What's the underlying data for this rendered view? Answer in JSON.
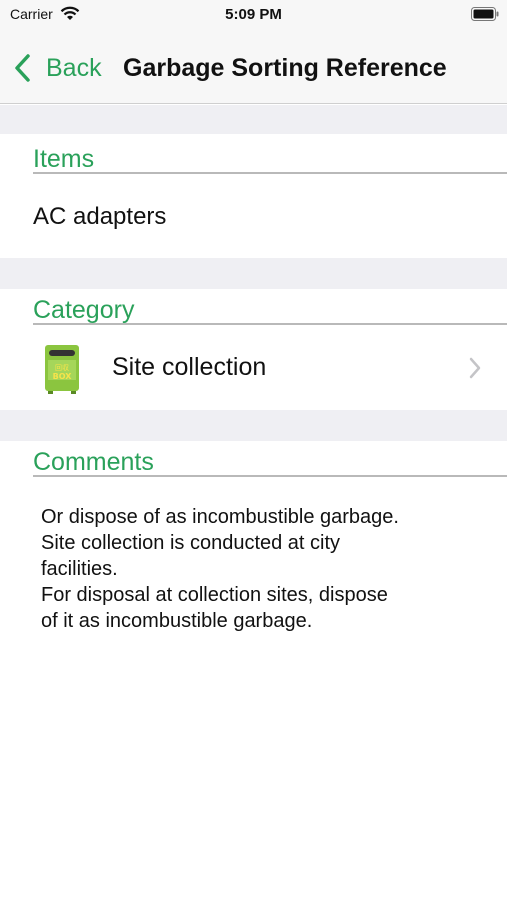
{
  "status_bar": {
    "carrier": "Carrier",
    "time": "5:09 PM",
    "wifi_icon": "wifi-icon",
    "battery_icon": "battery-icon"
  },
  "nav": {
    "back_label": "Back",
    "title": "Garbage Sorting Reference"
  },
  "items": {
    "header": "Items",
    "value": "AC adapters"
  },
  "category": {
    "header": "Category",
    "label": "Site collection",
    "icon": "recycle-box-icon",
    "icon_text": "BOX",
    "icon_kanji": "回収"
  },
  "comments": {
    "header": "Comments",
    "lines": [
      "Or dispose of as incombustible garbage.",
      "Site collection is conducted at city",
      "facilities.",
      "For disposal at collection sites, dispose",
      "of it as incombustible garbage."
    ]
  },
  "colors": {
    "accent": "#2aa15a",
    "section_background": "#efeff3"
  }
}
